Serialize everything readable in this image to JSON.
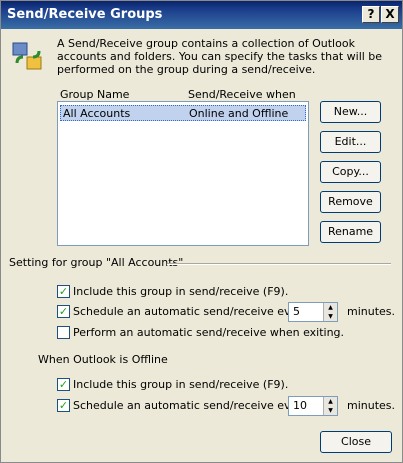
{
  "window": {
    "title": "Send/Receive Groups",
    "help_label": "?",
    "close_label": "X"
  },
  "description": "A Send/Receive group contains a collection of Outlook accounts and folders. You can specify the tasks that will be performed on the group during a send/receive.",
  "list": {
    "headers": [
      "Group Name",
      "Send/Receive when"
    ],
    "rows": [
      {
        "name": "All Accounts",
        "when": "Online and Offline"
      }
    ]
  },
  "buttons": {
    "new": "New...",
    "edit": "Edit...",
    "copy": "Copy...",
    "remove": "Remove",
    "rename": "Rename",
    "close": "Close"
  },
  "online": {
    "heading": "Setting for group \"All Accounts\"",
    "include_label": "Include this group in send/receive (F9).",
    "include_checked": true,
    "schedule_label": "Schedule an automatic send/receive every",
    "schedule_checked": true,
    "schedule_value": "5",
    "schedule_unit": "minutes.",
    "exit_label": "Perform an automatic send/receive when exiting.",
    "exit_checked": false
  },
  "offline": {
    "heading": "When Outlook is Offline",
    "include_label": "Include this group in send/receive (F9).",
    "include_checked": true,
    "schedule_label": "Schedule an automatic send/receive every",
    "schedule_checked": true,
    "schedule_value": "10",
    "schedule_unit": "minutes."
  }
}
